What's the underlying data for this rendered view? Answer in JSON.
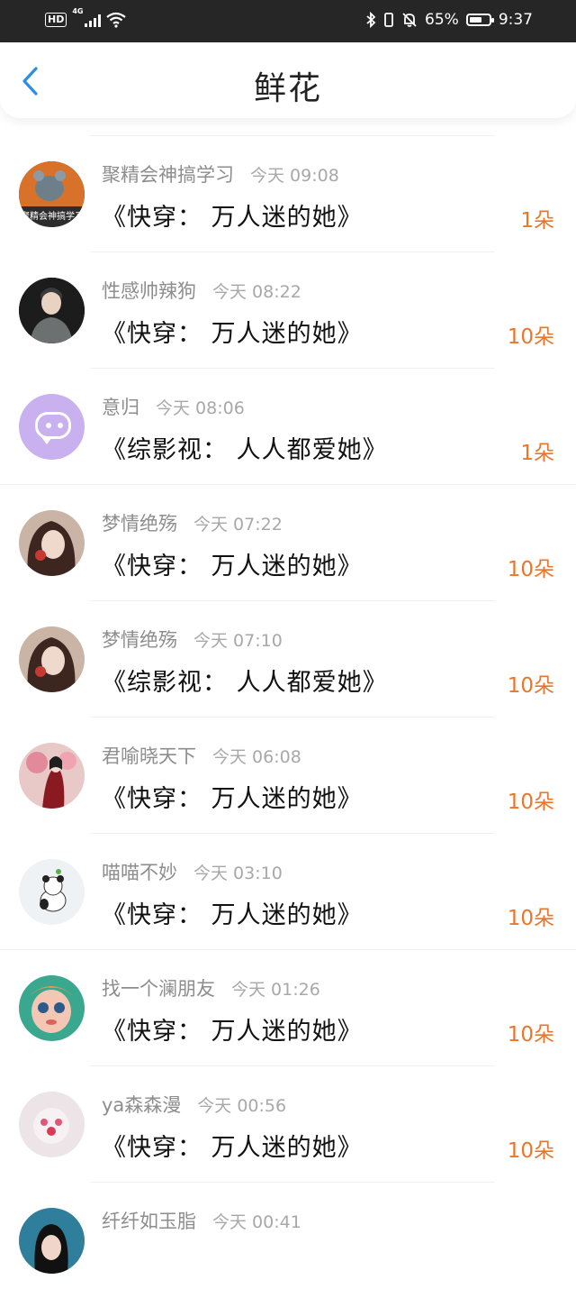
{
  "status_bar": {
    "hd": "HD",
    "network": "4G",
    "battery_percent": "65%",
    "battery_level": 0.65,
    "time": "9:37",
    "icons": [
      "bluetooth-icon",
      "mute-icon",
      "wifi-icon",
      "signal-icon"
    ]
  },
  "nav": {
    "title": "鲜花",
    "back_icon": "chevron-left-icon",
    "accent_color": "#2b8de8"
  },
  "count_color": "#e8762c",
  "items": [
    {
      "user": "聚精会神搞学习",
      "time": "今天 09:08",
      "book": "《快穿： 万人迷的她》",
      "count": "1朵",
      "avatar_text": "聚精会神搞学习"
    },
    {
      "user": "性感帅辣狗",
      "time": "今天 08:22",
      "book": "《快穿： 万人迷的她》",
      "count": "10朵"
    },
    {
      "user": "意归",
      "time": "今天 08:06",
      "book": "《综影视： 人人都爱她》",
      "count": "1朵"
    },
    {
      "user": "梦情绝殇",
      "time": "今天 07:22",
      "book": "《快穿： 万人迷的她》",
      "count": "10朵"
    },
    {
      "user": "梦情绝殇",
      "time": "今天 07:10",
      "book": "《综影视： 人人都爱她》",
      "count": "10朵"
    },
    {
      "user": "君喻晓天下",
      "time": "今天 06:08",
      "book": "《快穿： 万人迷的她》",
      "count": "10朵"
    },
    {
      "user": "喵喵不妙",
      "time": "今天 03:10",
      "book": "《快穿： 万人迷的她》",
      "count": "10朵"
    },
    {
      "user": "找一个澜朋友",
      "time": "今天 01:26",
      "book": "《快穿： 万人迷的她》",
      "count": "10朵"
    },
    {
      "user": "ya森森漫",
      "time": "今天 00:56",
      "book": "《快穿： 万人迷的她》",
      "count": "10朵"
    },
    {
      "user": "纤纤如玉脂",
      "time": "今天 00:41",
      "book": "",
      "count": ""
    }
  ]
}
